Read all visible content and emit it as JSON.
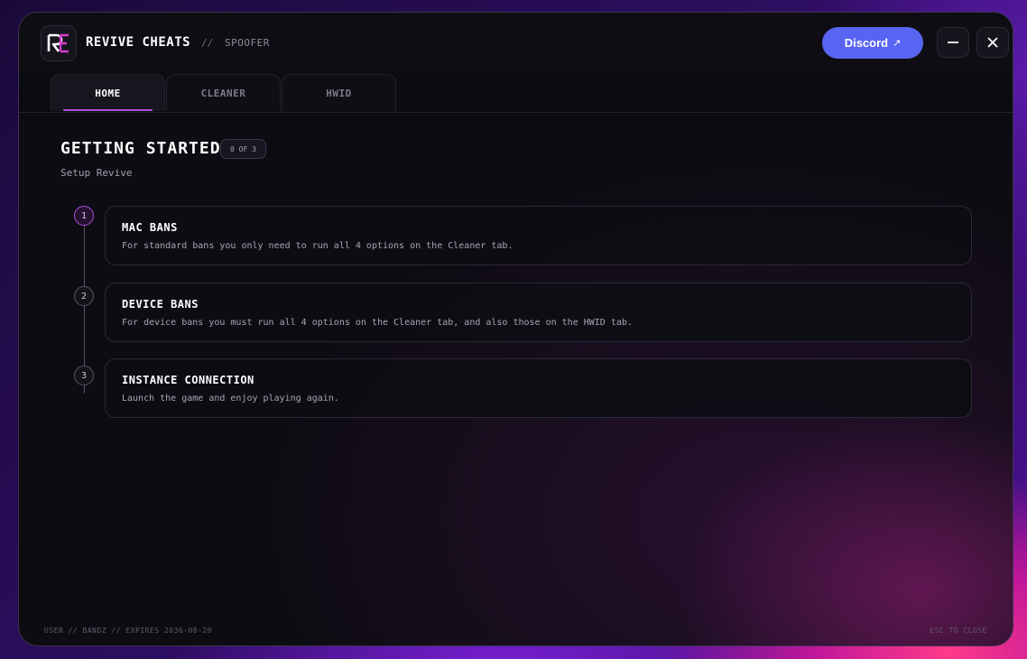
{
  "header": {
    "app_title": "REVIVE CHEATS",
    "separator": "//",
    "subtitle": "SPOOFER",
    "discord_label": "Discord",
    "discord_arrow": "↗"
  },
  "tabs": [
    {
      "label": "HOME",
      "active": true
    },
    {
      "label": "CLEANER",
      "active": false
    },
    {
      "label": "HWID",
      "active": false
    }
  ],
  "main": {
    "heading": "GETTING STARTED",
    "progress_badge": "0 OF 3",
    "subheading": "Setup Revive",
    "steps": [
      {
        "number": "1",
        "title": "MAC BANS",
        "description": "For standard bans you only need to run all 4 options on the Cleaner tab."
      },
      {
        "number": "2",
        "title": "DEVICE BANS",
        "description": "For device bans you must run all 4 options on the Cleaner tab, and also those on the HWID tab."
      },
      {
        "number": "3",
        "title": "INSTANCE CONNECTION",
        "description": "Launch the game and enjoy playing again."
      }
    ]
  },
  "footer": {
    "user_info": "USER // BANDZ  //  EXPIRES 2036-08-20",
    "close_hint": "ESC TO CLOSE"
  },
  "colors": {
    "accent": "#b04de0",
    "discord": "#5865f2",
    "background": "#0d0c12"
  },
  "icons": {
    "logo": "revive-logo-icon",
    "minimize": "minimize-icon",
    "close": "close-icon"
  }
}
